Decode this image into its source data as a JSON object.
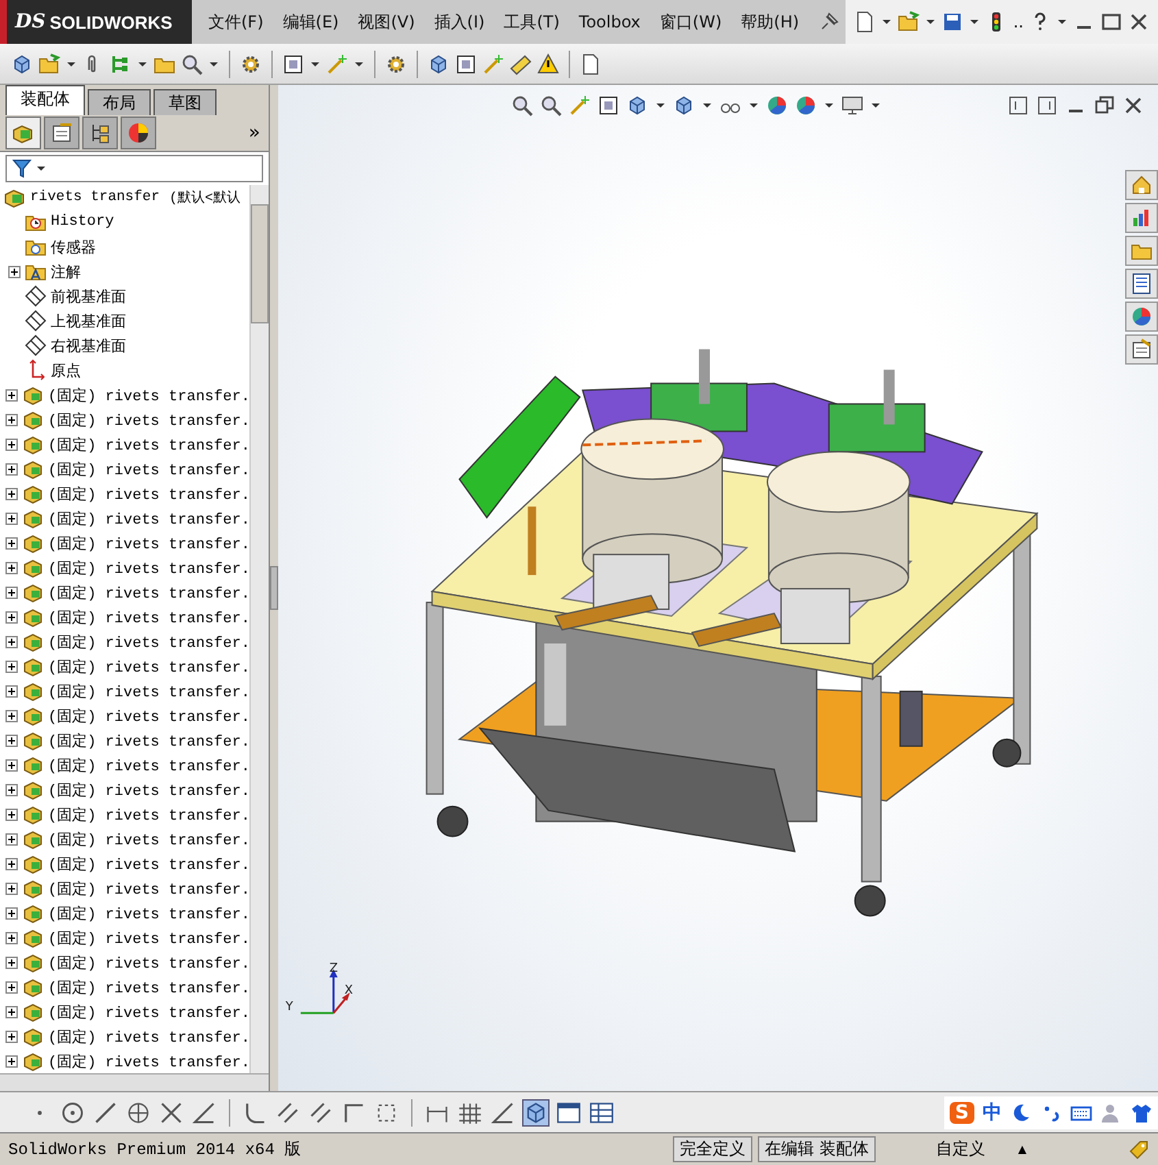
{
  "app": {
    "logo_mark": "DS",
    "logo": "SOLIDWORKS"
  },
  "menus": [
    "文件(F)",
    "编辑(E)",
    "视图(V)",
    "插入(I)",
    "工具(T)",
    "Toolbox",
    "窗口(W)",
    "帮助(H)"
  ],
  "quick_access": {
    "more": ".."
  },
  "panel": {
    "tabs": [
      {
        "label": "装配体",
        "selected": true
      },
      {
        "label": "布局",
        "selected": false
      },
      {
        "label": "草图",
        "selected": false
      }
    ],
    "collapse": "»",
    "icon_tabs": [
      {
        "selected": true
      },
      {
        "selected": false
      },
      {
        "selected": false
      },
      {
        "selected": false
      }
    ]
  },
  "tree": {
    "root": {
      "label": "rivets transfer",
      "config": "(默认<默认"
    },
    "items": [
      {
        "kind": "history",
        "label": "History",
        "expander": false
      },
      {
        "kind": "sensor",
        "label": "传感器",
        "expander": false
      },
      {
        "kind": "annotation",
        "label": "注解",
        "expander": true
      },
      {
        "kind": "plane",
        "label": "前视基准面",
        "expander": false
      },
      {
        "kind": "plane",
        "label": "上视基准面",
        "expander": false
      },
      {
        "kind": "plane",
        "label": "右视基准面",
        "expander": false
      },
      {
        "kind": "origin",
        "label": "原点",
        "expander": false
      },
      {
        "kind": "part",
        "label": "(固定) rivets transfer.",
        "expander": true
      },
      {
        "kind": "part",
        "label": "(固定) rivets transfer.",
        "expander": true
      },
      {
        "kind": "part",
        "label": "(固定) rivets transfer.",
        "expander": true
      },
      {
        "kind": "part",
        "label": "(固定) rivets transfer.",
        "expander": true
      },
      {
        "kind": "part",
        "label": "(固定) rivets transfer.",
        "expander": true
      },
      {
        "kind": "part",
        "label": "(固定) rivets transfer.",
        "expander": true
      },
      {
        "kind": "part",
        "label": "(固定) rivets transfer.",
        "expander": true
      },
      {
        "kind": "part",
        "label": "(固定) rivets transfer.",
        "expander": true
      },
      {
        "kind": "part",
        "label": "(固定) rivets transfer.",
        "expander": true
      },
      {
        "kind": "part",
        "label": "(固定) rivets transfer.",
        "expander": true
      },
      {
        "kind": "part",
        "label": "(固定) rivets transfer.",
        "expander": true
      },
      {
        "kind": "part",
        "label": "(固定) rivets transfer.",
        "expander": true
      },
      {
        "kind": "part",
        "label": "(固定) rivets transfer.",
        "expander": true
      },
      {
        "kind": "part",
        "label": "(固定) rivets transfer.",
        "expander": true
      },
      {
        "kind": "part",
        "label": "(固定) rivets transfer.",
        "expander": true
      },
      {
        "kind": "part",
        "label": "(固定) rivets transfer.",
        "expander": true
      },
      {
        "kind": "part",
        "label": "(固定) rivets transfer.",
        "expander": true
      },
      {
        "kind": "part",
        "label": "(固定) rivets transfer.",
        "expander": true
      },
      {
        "kind": "part",
        "label": "(固定) rivets transfer.",
        "expander": true
      },
      {
        "kind": "part",
        "label": "(固定) rivets transfer.",
        "expander": true
      },
      {
        "kind": "part",
        "label": "(固定) rivets transfer.",
        "expander": true
      },
      {
        "kind": "part",
        "label": "(固定) rivets transfer.",
        "expander": true
      },
      {
        "kind": "part",
        "label": "(固定) rivets transfer.",
        "expander": true
      },
      {
        "kind": "part",
        "label": "(固定) rivets transfer.",
        "expander": true
      },
      {
        "kind": "part",
        "label": "(固定) rivets transfer.",
        "expander": true
      },
      {
        "kind": "part",
        "label": "(固定) rivets transfer.",
        "expander": true
      },
      {
        "kind": "part",
        "label": "(固定) rivets transfer.",
        "expander": true
      },
      {
        "kind": "part",
        "label": "(固定) rivets transfer.",
        "expander": true
      }
    ]
  },
  "triad": {
    "x": "X",
    "y": "Y",
    "z": "Z"
  },
  "ime": {
    "logo": "S",
    "mode": "中"
  },
  "status_bar": {
    "product": "SolidWorks Premium 2014 x64 版",
    "state": "完全定义",
    "editing": "在编辑 装配体",
    "units": "自定义",
    "caret": "▲"
  }
}
